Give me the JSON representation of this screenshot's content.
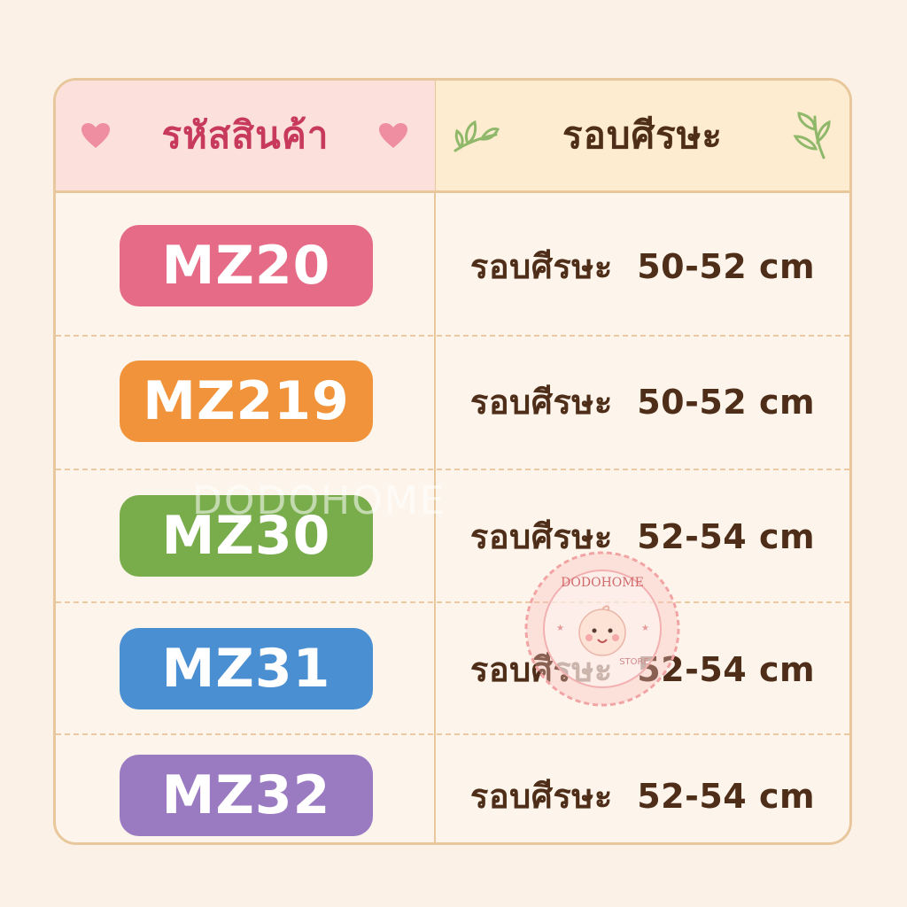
{
  "header": {
    "code_label": "รหัสสินค้า",
    "size_label": "รอบศีรษะ"
  },
  "rows": [
    {
      "code": "MZ20",
      "size": "รอบศีรษะ  50-52 cm",
      "color": "#e66b86"
    },
    {
      "code": "MZ219",
      "size": "รอบศีรษะ  50-52 cm",
      "color": "#f0933a"
    },
    {
      "code": "MZ30",
      "size": "รอบศีรษะ  52-54 cm",
      "color": "#79ad4c"
    },
    {
      "code": "MZ31",
      "size": "รอบศีรษะ  52-54 cm",
      "color": "#4a8fd1"
    },
    {
      "code": "MZ32",
      "size": "รอบศีรษะ  52-54 cm",
      "color": "#9a7bc2"
    }
  ],
  "watermark": "DODOHOME",
  "stamp": {
    "brand": "DODOHOME",
    "store": "STORE"
  },
  "colors": {
    "background": "#fbf1e6",
    "border": "#e8c79c",
    "header_left_bg": "#fbe0dc",
    "header_right_bg": "#fdeccf",
    "header_left_text": "#c83a5c",
    "body_text": "#4e2e18"
  },
  "icons": [
    "heart-icon",
    "leaf-sprig-icon",
    "baby-face-icon"
  ]
}
